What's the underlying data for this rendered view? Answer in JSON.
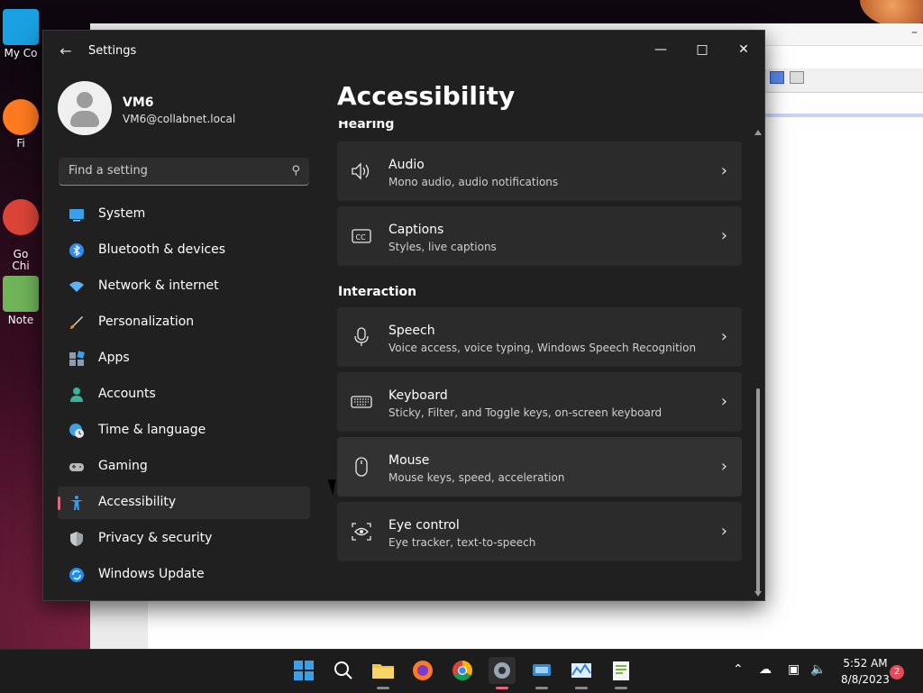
{
  "desktop": {
    "icons": [
      {
        "label": "My Co",
        "color": "#19a1e3"
      },
      {
        "label": "Fi",
        "color": "#ff7a20"
      },
      {
        "label": "Go\nChi",
        "color": "#db4437"
      },
      {
        "label": "Note",
        "color": "#70b45a"
      }
    ]
  },
  "settings": {
    "app_title": "Settings",
    "user": {
      "name": "VM6",
      "email": "VM6@collabnet.local"
    },
    "search_placeholder": "Find a setting",
    "nav": [
      {
        "label": "System",
        "icon": "monitor-icon",
        "color": "#3aa1e8"
      },
      {
        "label": "Bluetooth & devices",
        "icon": "bluetooth-icon",
        "color": "#2f8bf0"
      },
      {
        "label": "Network & internet",
        "icon": "wifi-icon",
        "color": "#5ab4f3"
      },
      {
        "label": "Personalization",
        "icon": "brush-icon",
        "color": "#e58a3c"
      },
      {
        "label": "Apps",
        "icon": "apps-icon",
        "color": "#8a9bb3"
      },
      {
        "label": "Accounts",
        "icon": "person-icon",
        "color": "#35b59a"
      },
      {
        "label": "Time & language",
        "icon": "globe-clock-icon",
        "color": "#3aa1e8"
      },
      {
        "label": "Gaming",
        "icon": "gamepad-icon",
        "color": "#b9b9b9"
      },
      {
        "label": "Accessibility",
        "icon": "accessibility-icon",
        "color": "#3a9cf0",
        "active": true
      },
      {
        "label": "Privacy & security",
        "icon": "shield-icon",
        "color": "#9aa0a8"
      },
      {
        "label": "Windows Update",
        "icon": "update-icon",
        "color": "#1f8ef1"
      }
    ],
    "page_title": "Accessibility",
    "sections": {
      "hearing": "Hearing",
      "interaction": "Interaction"
    },
    "cards": [
      {
        "title": "Audio",
        "subtitle": "Mono audio, audio notifications",
        "icon": "speaker-icon"
      },
      {
        "title": "Captions",
        "subtitle": "Styles, live captions",
        "icon": "captions-icon"
      },
      {
        "title": "Speech",
        "subtitle": "Voice access, voice typing, Windows Speech Recognition",
        "icon": "microphone-icon"
      },
      {
        "title": "Keyboard",
        "subtitle": "Sticky, Filter, and Toggle keys, on-screen keyboard",
        "icon": "keyboard-icon"
      },
      {
        "title": "Mouse",
        "subtitle": "Mouse keys, speed, acceleration",
        "icon": "mouse-icon"
      },
      {
        "title": "Eye control",
        "subtitle": "Eye tracker, text-to-speech",
        "icon": "eye-control-icon"
      }
    ]
  },
  "taskbar": {
    "apps": [
      {
        "name": "start-icon",
        "color": "#3aa1e8"
      },
      {
        "name": "search-icon",
        "color": "#ffffff"
      },
      {
        "name": "file-explorer-icon",
        "color": "#f2c33a"
      },
      {
        "name": "firefox-icon",
        "color": "#ff7a20"
      },
      {
        "name": "chrome-icon",
        "color": "#db4437"
      },
      {
        "name": "settings-icon",
        "color": "#9aa6b5",
        "active": true
      },
      {
        "name": "remote-desktop-icon",
        "color": "#2f8bd8"
      },
      {
        "name": "performance-monitor-icon",
        "color": "#3a7fd0"
      },
      {
        "name": "notepad-plus-icon",
        "color": "#76b83f"
      }
    ],
    "time": "5:52 AM",
    "date": "8/8/2023",
    "notification_count": "2"
  }
}
